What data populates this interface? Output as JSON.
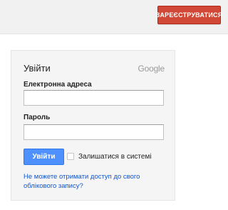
{
  "header": {
    "signup_label": "ЗАРЕЄСТРУВАТИСЯ"
  },
  "signin": {
    "title": "Увійти",
    "logo_text": "Google",
    "email_label": "Електронна адреса",
    "email_value": "",
    "password_label": "Пароль",
    "password_value": "",
    "submit_label": "Увійти",
    "remember_label": "Залишатися в системі",
    "remember_checked": false,
    "help_link": "Не можете отримати доступ до свого облікового запису?"
  },
  "colors": {
    "signup_red": "#d14836",
    "signin_blue": "#4d90fe",
    "link_blue": "#1155cc"
  }
}
